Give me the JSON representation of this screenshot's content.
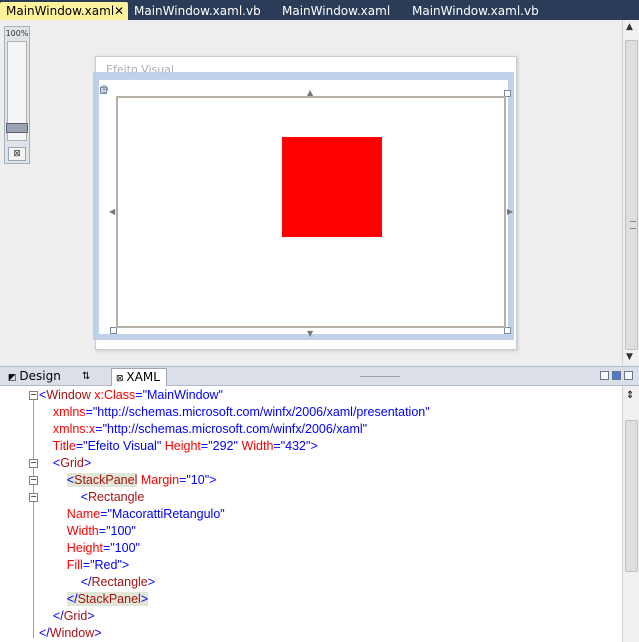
{
  "tabs": [
    {
      "label": "MainWindow.xaml",
      "active": true,
      "close": "✕"
    },
    {
      "label": "MainWindow.xaml.vb",
      "active": false
    },
    {
      "label": "MainWindow.xaml",
      "active": false
    },
    {
      "label": "MainWindow.xaml.vb",
      "active": false
    }
  ],
  "zoom": {
    "label": "100%",
    "level_fraction": 0.9,
    "fit_icon": "fit-to-window-icon"
  },
  "preview": {
    "window_title": "Efeito Visual",
    "rect_color": "#ff0000"
  },
  "pane": {
    "design_label": "Design",
    "swap_icon": "⇅",
    "xaml_label": "XAML"
  },
  "code": {
    "lines": [
      "<Window x:Class=\"MainWindow\"",
      "    xmlns=\"http://schemas.microsoft.com/winfx/2006/xaml/presentation\"",
      "    xmlns:x=\"http://schemas.microsoft.com/winfx/2006/xaml\"",
      "    Title=\"Efeito Visual\" Height=\"292\" Width=\"432\">",
      "    <Grid>",
      "        <StackPanel Margin=\"10\">",
      "            <Rectangle",
      "        Name=\"MacorattiRetangulo\"",
      "        Width=\"100\"",
      "        Height=\"100\"",
      "        Fill=\"Red\">",
      "            </Rectangle>",
      "        </StackPanel>",
      "    </Grid>",
      "</Window>"
    ]
  },
  "colors": {
    "tab_bar": "#2b3c59",
    "active_tab": "#fff29d",
    "tag": "#a31515",
    "attribute": "#ff0000",
    "value": "#0000ff"
  }
}
